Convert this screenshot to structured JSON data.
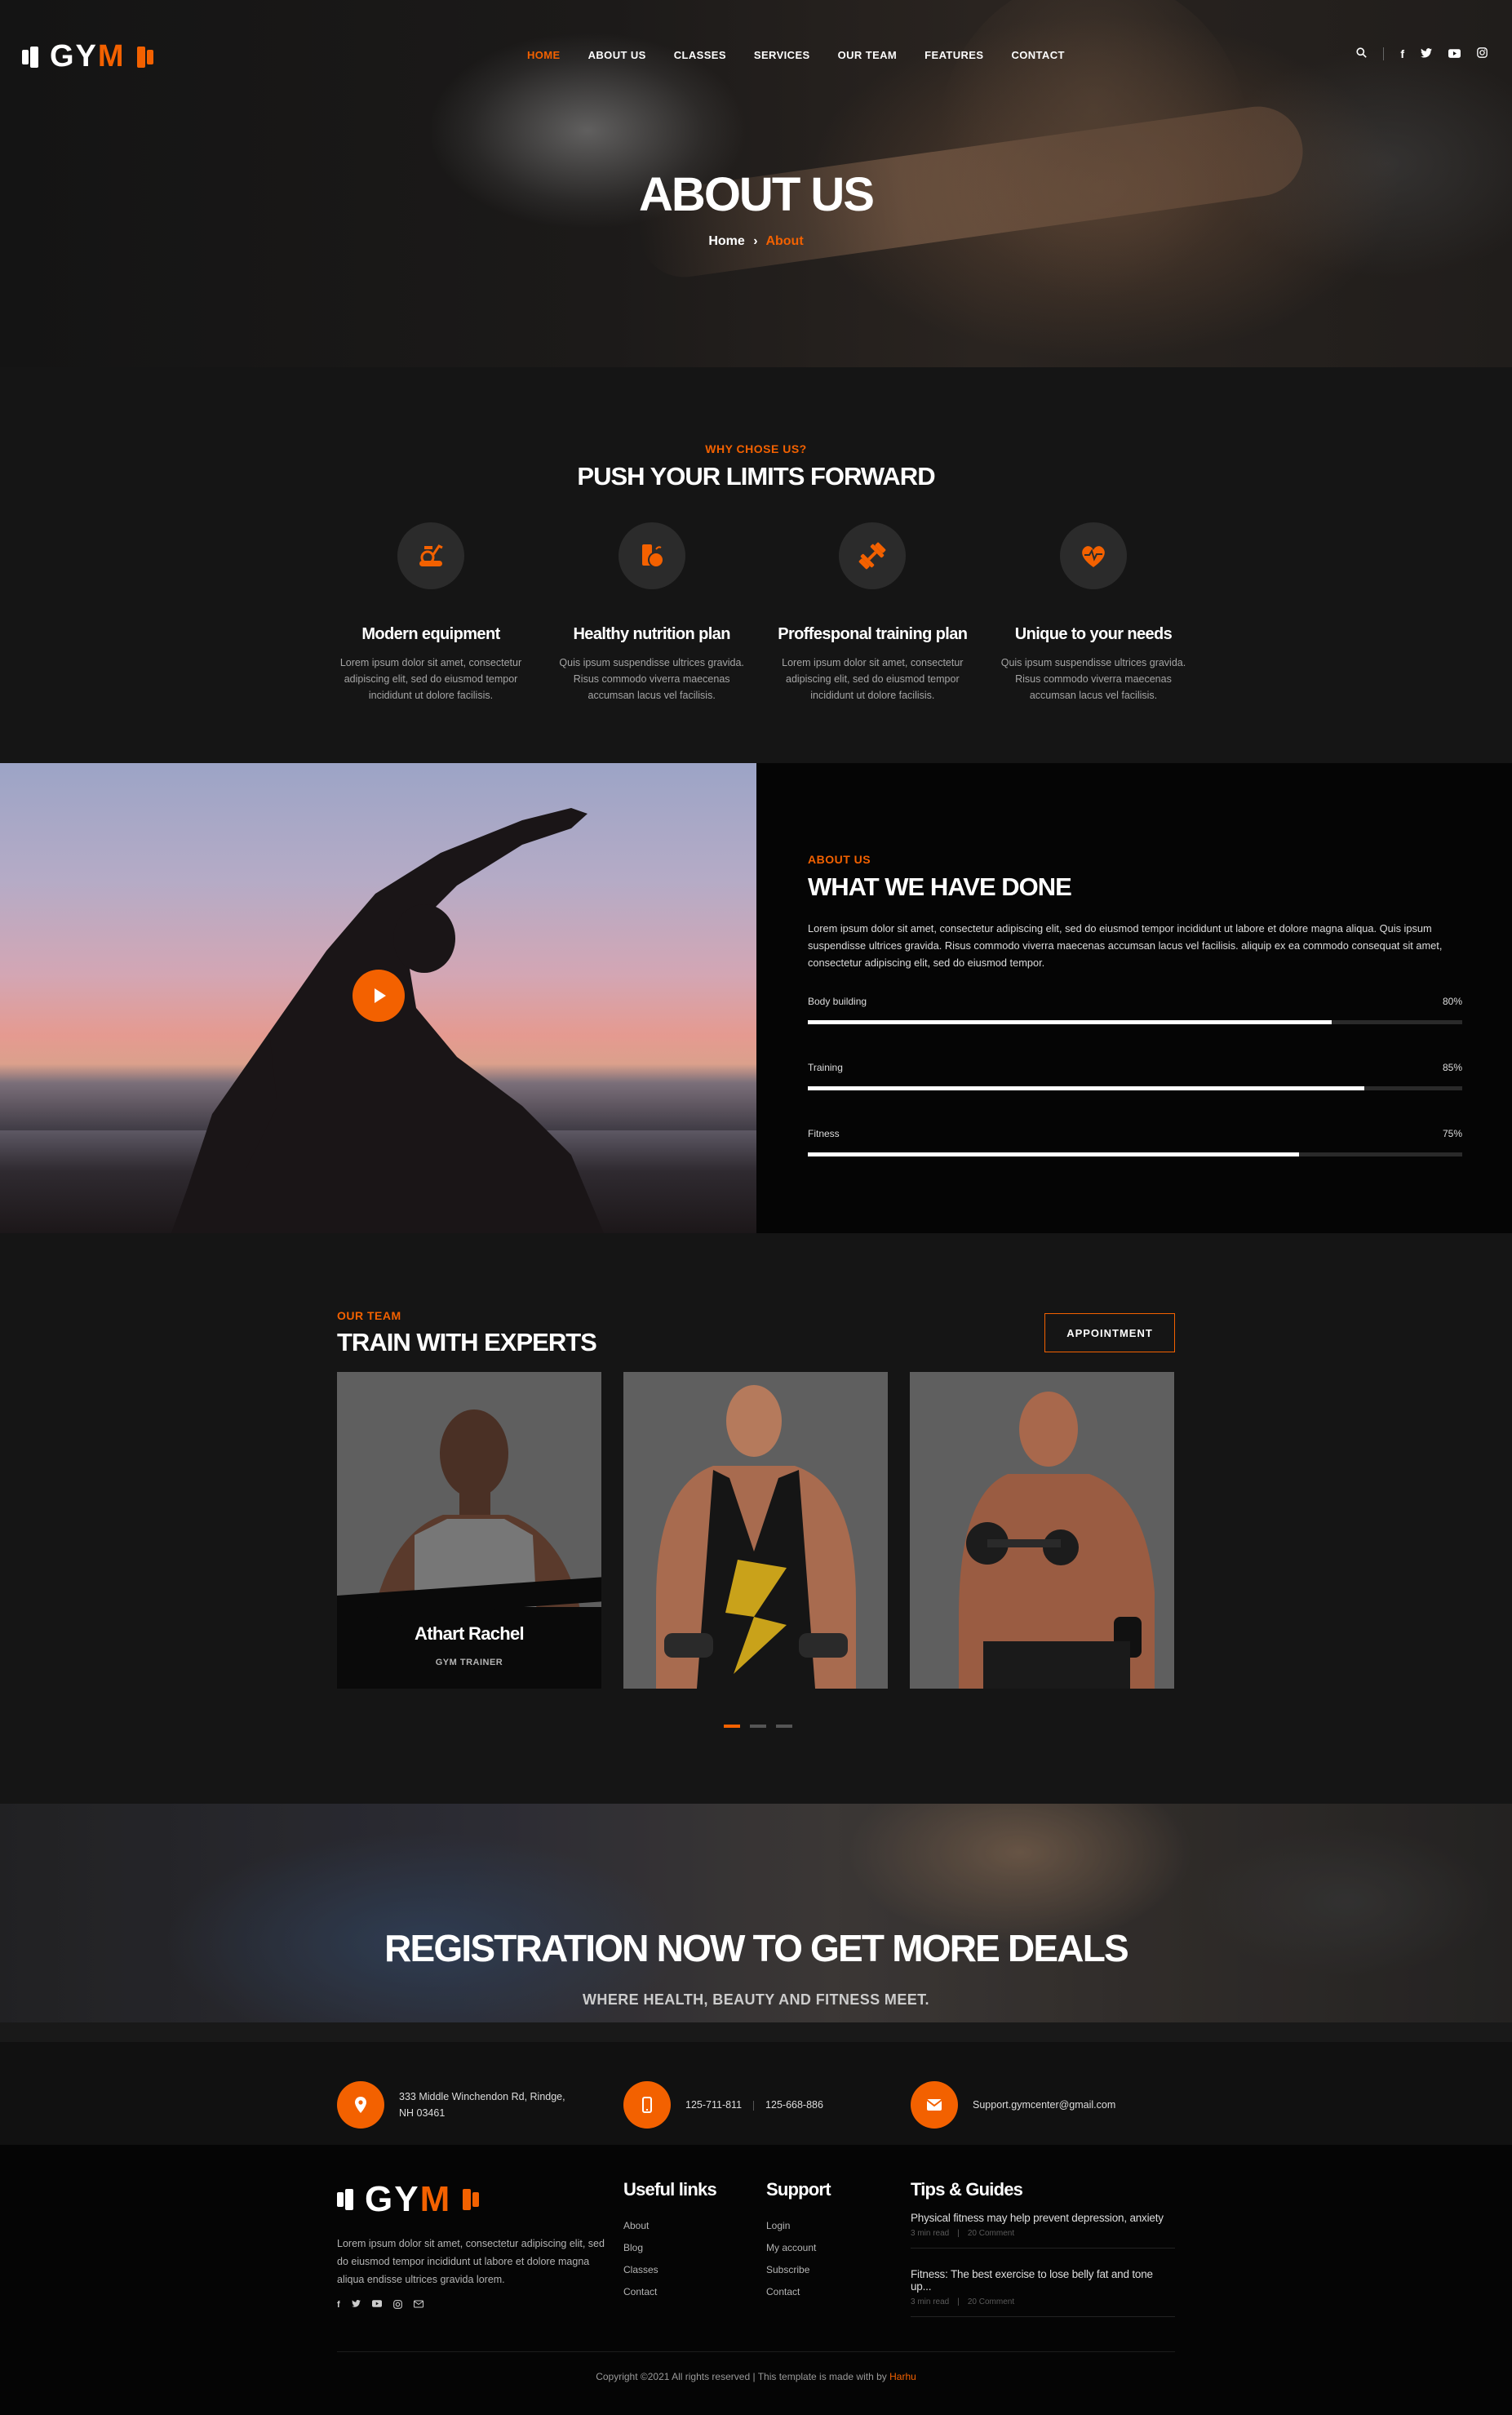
{
  "brand": {
    "logo_text_a": "GY",
    "logo_text_b": "M"
  },
  "nav": {
    "items": [
      "HOME",
      "ABOUT US",
      "CLASSES",
      "SERVICES",
      "OUR TEAM",
      "FEATURES",
      "CONTACT"
    ],
    "active": "HOME"
  },
  "hero": {
    "title": "ABOUT US",
    "crumb_home": "Home",
    "crumb_sep": "›",
    "crumb_current": "About"
  },
  "why": {
    "subtitle": "WHY CHOSE US?",
    "title": "PUSH YOUR LIMITS FORWARD",
    "features": [
      {
        "icon": "exercise-bike-icon",
        "title": "Modern equipment",
        "text": "Lorem ipsum dolor sit amet, consectetur adipiscing elit, sed do eiusmod tempor incididunt ut dolore facilisis."
      },
      {
        "icon": "nutrition-icon",
        "title": "Healthy nutrition plan",
        "text": "Quis ipsum suspendisse ultrices gravida. Risus commodo viverra maecenas accumsan lacus vel facilisis."
      },
      {
        "icon": "dumbbell-icon",
        "title": "Proffesponal training plan",
        "text": "Lorem ipsum dolor sit amet, consectetur adipiscing elit, sed do eiusmod tempor incididunt ut dolore facilisis."
      },
      {
        "icon": "heartbeat-icon",
        "title": "Unique to your needs",
        "text": "Quis ipsum suspendisse ultrices gravida. Risus commodo viverra maecenas accumsan lacus vel facilisis."
      }
    ]
  },
  "about": {
    "subtitle": "ABOUT US",
    "title": "WHAT WE HAVE DONE",
    "desc": "Lorem ipsum dolor sit amet, consectetur adipiscing elit, sed do eiusmod tempor incididunt ut labore et dolore magna aliqua. Quis ipsum suspendisse ultrices gravida. Risus commodo viverra maecenas accumsan lacus vel facilisis. aliquip ex ea commodo consequat sit amet, consectetur adipiscing elit, sed do eiusmod tempor.",
    "skills": [
      {
        "label": "Body building",
        "percent_text": "80%",
        "value": 0.8
      },
      {
        "label": "Training",
        "percent_text": "85%",
        "value": 0.85
      },
      {
        "label": "Fitness",
        "percent_text": "75%",
        "value": 0.75
      }
    ]
  },
  "team": {
    "subtitle": "OUR TEAM",
    "title": "TRAIN WITH EXPERTS",
    "button": "APPOINTMENT",
    "member_name": "Athart Rachel",
    "member_role": "GYM TRAINER"
  },
  "banner": {
    "title": "REGISTRATION NOW TO GET MORE DEALS",
    "subtitle": "WHERE HEALTH, BEAUTY AND FITNESS MEET."
  },
  "contact": {
    "address_1": "333 Middle Winchendon Rd, Rindge,",
    "address_2": "NH 03461",
    "phone_1": "125-711-811",
    "phone_2": "125-668-886",
    "email": "Support.gymcenter@gmail.com"
  },
  "footer": {
    "desc": "Lorem ipsum dolor sit amet, consectetur adipiscing elit, sed do eiusmod tempor incididunt ut labore et dolore magna aliqua endisse ultrices gravida lorem.",
    "useful_title": "Useful links",
    "useful": [
      "About",
      "Blog",
      "Classes",
      "Contact"
    ],
    "support_title": "Support",
    "support": [
      "Login",
      "My account",
      "Subscribe",
      "Contact"
    ],
    "tips_title": "Tips & Guides",
    "tips": [
      {
        "title": "Physical fitness may help prevent depression, anxiety",
        "time": "3 min read",
        "comments": "20 Comment"
      },
      {
        "title": "Fitness: The best exercise to lose belly fat and tone up...",
        "time": "3 min read",
        "comments": "20 Comment"
      }
    ],
    "copyright": "Copyright ©2021 All rights reserved | This template is made with by",
    "credit": "Harhu"
  },
  "colors": {
    "accent": "#f36100",
    "bg_dark": "#151515",
    "bg_black": "#050505"
  }
}
